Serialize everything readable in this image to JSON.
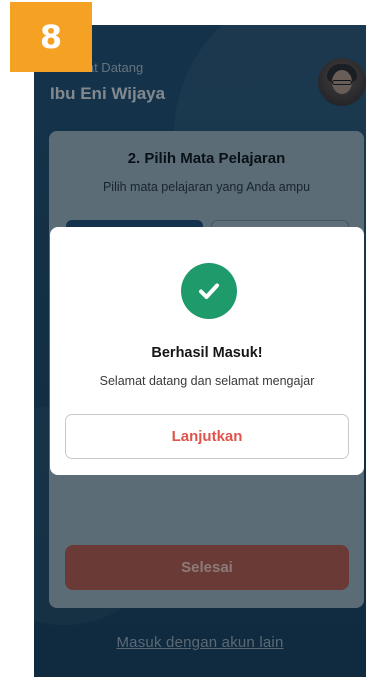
{
  "step_badge": "8",
  "header": {
    "greeting": "Selamat Datang",
    "user_name": "Ibu Eni Wijaya"
  },
  "card": {
    "title": "2. Pilih Mata Pelajaran",
    "subtitle": "Pilih mata pelajaran yang Anda ampu",
    "finish_label": "Selesai"
  },
  "alt_login": "Masuk dengan akun lain",
  "modal": {
    "icon": "check-circle-icon",
    "title": "Berhasil Masuk!",
    "message": "Selamat datang dan selamat mengajar",
    "continue_label": "Lanjutkan"
  },
  "colors": {
    "background": "#1f4f73",
    "success": "#1f9a6a",
    "accent": "#e0544b",
    "badge": "#f4a124"
  }
}
